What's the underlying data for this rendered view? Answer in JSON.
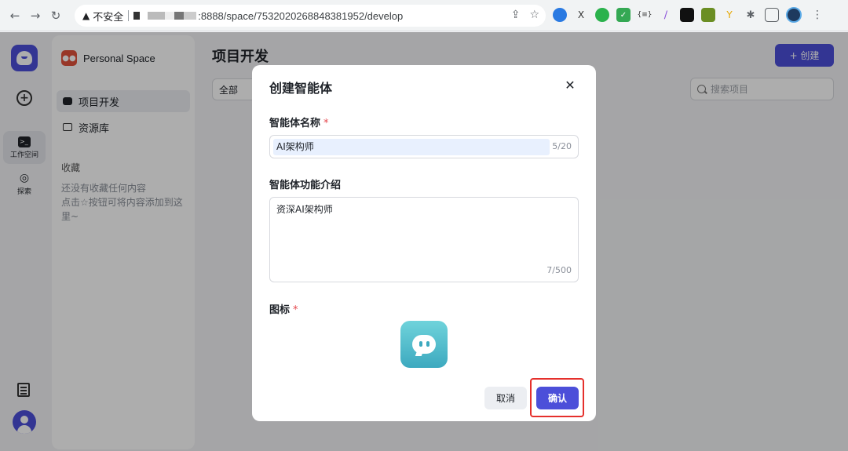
{
  "browser": {
    "security_label": "不安全",
    "url": ":8888/space/7532020268848381952/develop"
  },
  "rail": {
    "workspace_label": "工作空间",
    "explore_label": "探索"
  },
  "sidebar": {
    "space_name": "Personal Space",
    "nav": [
      {
        "label": "项目开发"
      },
      {
        "label": "资源库"
      }
    ],
    "favorites_title": "收藏",
    "favorites_empty": "还没有收藏任何内容\n点击☆按钮可将内容添加到这里~"
  },
  "main": {
    "title": "项目开发",
    "create_label": "+ 创建",
    "filter_value": "全部",
    "search_placeholder": "搜索项目"
  },
  "modal": {
    "title": "创建智能体",
    "name_label": "智能体名称",
    "name_value": "AI架构师",
    "name_count": "5/20",
    "desc_label": "智能体功能介绍",
    "desc_value": "资深AI架构师",
    "desc_count": "7/500",
    "icon_label": "图标",
    "required_mark": "*",
    "cancel_label": "取消",
    "confirm_label": "确认"
  },
  "colors": {
    "accent": "#4c4fd9",
    "highlight": "#e5302c",
    "space_badge": "#e0523c"
  }
}
